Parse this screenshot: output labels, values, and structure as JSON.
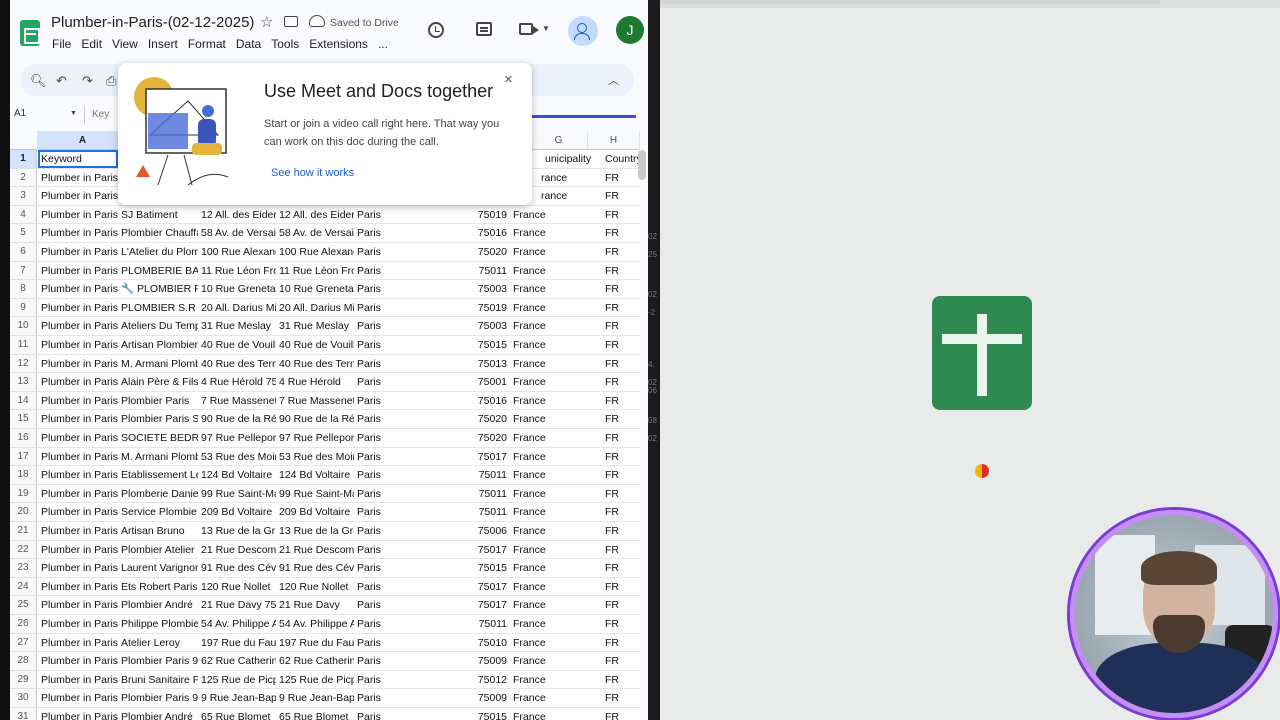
{
  "doc": {
    "title": "Plumber-in-Paris-(02-12-2025)",
    "saved_status": "Saved to Drive",
    "avatar_letter": "J",
    "menu": [
      "File",
      "Edit",
      "View",
      "Insert",
      "Format",
      "Data",
      "Tools",
      "Extensions",
      "..."
    ],
    "name_box": "A1",
    "formula_preview": "Key"
  },
  "popup": {
    "title": "Use Meet and Docs together",
    "body": "Start or join a video call right here. That way you can work on this doc during the call.",
    "link": "See how it works",
    "close": "×"
  },
  "grid": {
    "columns": [
      "A",
      "G",
      "H"
    ],
    "header_row": {
      "row_number": "1",
      "keyword": "Keyword",
      "municipality": "unicipality",
      "country": "Country"
    },
    "rows": [
      {
        "n": "2",
        "a": "Plumber in Paris",
        "b": "",
        "c": "",
        "d": "",
        "e": "",
        "f": "rance",
        "g": "FR"
      },
      {
        "n": "3",
        "a": "Plumber in Paris",
        "b": "",
        "c": "",
        "d": "",
        "e": "",
        "f": "rance",
        "g": "FR"
      },
      {
        "n": "4",
        "a": "Plumber in Paris",
        "b": "SJ Batiment",
        "c": "12 All. des Eider",
        "d": "12 All. des Eider",
        "e": "Paris",
        "z": "75019",
        "f": "France",
        "g": "FR"
      },
      {
        "n": "5",
        "a": "Plumber in Paris",
        "b": "Plombier Chauffa",
        "c": "58 Av. de Versail",
        "d": "58 Av. de Versail",
        "e": "Paris",
        "z": "75016",
        "f": "France",
        "g": "FR"
      },
      {
        "n": "6",
        "a": "Plumber in Paris",
        "b": "L'Atelier du Plom",
        "c": "100 Rue Alexand",
        "d": "100 Rue Alexand",
        "e": "Paris",
        "z": "75020",
        "f": "France",
        "g": "FR"
      },
      {
        "n": "7",
        "a": "Plumber in Paris",
        "b": "PLOMBERIE BA",
        "c": "11 Rue Léon Fro",
        "d": "11 Rue Léon Fro",
        "e": "Paris",
        "z": "75011",
        "f": "France",
        "g": "FR"
      },
      {
        "n": "8",
        "a": "Plumber in Paris",
        "b": "🔧 PLOMBIER P",
        "c": "10 Rue Greneta",
        "d": "10 Rue Greneta",
        "e": "Paris",
        "z": "75003",
        "f": "France",
        "g": "FR"
      },
      {
        "n": "9",
        "a": "Plumber in Paris",
        "b": "PLOMBIER S.R",
        "c": "20 All. Darius Mi",
        "d": "20 All. Darius Mi",
        "e": "Paris",
        "z": "75019",
        "f": "France",
        "g": "FR"
      },
      {
        "n": "10",
        "a": "Plumber in Paris",
        "b": "Ateliers Du Temp",
        "c": "31 Rue Meslay",
        "d": "31 Rue Meslay",
        "e": "Paris",
        "z": "75003",
        "f": "France",
        "g": "FR"
      },
      {
        "n": "11",
        "a": "Plumber in Paris",
        "b": "Artisan Plombier",
        "c": "40 Rue de Vouill",
        "d": "40 Rue de Vouill",
        "e": "Paris",
        "z": "75015",
        "f": "France",
        "g": "FR"
      },
      {
        "n": "12",
        "a": "Plumber in Paris",
        "b": "M. Armani Plomb",
        "c": "40 Rue des Tern",
        "d": "40 Rue des Tern",
        "e": "Paris",
        "z": "75013",
        "f": "France",
        "g": "FR"
      },
      {
        "n": "13",
        "a": "Plumber in Paris",
        "b": "Alain Père & Fils",
        "c": "4 Rue Hérold 75",
        "d": "4 Rue Hérold",
        "e": "Paris",
        "z": "75001",
        "f": "France",
        "g": "FR"
      },
      {
        "n": "14",
        "a": "Plumber in Paris",
        "b": "Plombier Paris",
        "c": "7 Rue Massenet",
        "d": "7 Rue Massenet",
        "e": "Paris",
        "z": "75016",
        "f": "France",
        "g": "FR"
      },
      {
        "n": "15",
        "a": "Plumber in Paris",
        "b": "Plombier Paris S",
        "c": "90 Rue de la Ré",
        "d": "90 Rue de la Ré",
        "e": "Paris",
        "z": "75020",
        "f": "France",
        "g": "FR"
      },
      {
        "n": "16",
        "a": "Plumber in Paris",
        "b": "SOCIETE BEDR",
        "c": "97 Rue Pellepor",
        "d": "97 Rue Pellepor",
        "e": "Paris",
        "z": "75020",
        "f": "France",
        "g": "FR"
      },
      {
        "n": "17",
        "a": "Plumber in Paris",
        "b": "M. Armani Plomb",
        "c": "53 Rue des Moir",
        "d": "53 Rue des Moir",
        "e": "Paris",
        "z": "75017",
        "f": "France",
        "g": "FR"
      },
      {
        "n": "18",
        "a": "Plumber in Paris",
        "b": "Etablissement Le",
        "c": "124 Bd Voltaire",
        "d": "124 Bd Voltaire",
        "e": "Paris",
        "z": "75011",
        "f": "France",
        "g": "FR"
      },
      {
        "n": "19",
        "a": "Plumber in Paris",
        "b": "Plomberie Danie",
        "c": "99 Rue Saint-Ma",
        "d": "99 Rue Saint-Ma",
        "e": "Paris",
        "z": "75011",
        "f": "France",
        "g": "FR"
      },
      {
        "n": "20",
        "a": "Plumber in Paris",
        "b": "Service Plombie",
        "c": "209 Bd Voltaire",
        "d": "209 Bd Voltaire",
        "e": "Paris",
        "z": "75011",
        "f": "France",
        "g": "FR"
      },
      {
        "n": "21",
        "a": "Plumber in Paris",
        "b": "Artisan Bruno",
        "c": "13 Rue de la Gr",
        "d": "13 Rue de la Gra",
        "e": "Paris",
        "z": "75006",
        "f": "France",
        "g": "FR"
      },
      {
        "n": "22",
        "a": "Plumber in Paris",
        "b": "Plombier Atelier",
        "c": "21 Rue Descom",
        "d": "21 Rue Descomb",
        "e": "Paris",
        "z": "75017",
        "f": "France",
        "g": "FR"
      },
      {
        "n": "23",
        "a": "Plumber in Paris",
        "b": "Laurent Varignor",
        "c": "91 Rue des Cév",
        "d": "91 Rue des Cév",
        "e": "Paris",
        "z": "75015",
        "f": "France",
        "g": "FR"
      },
      {
        "n": "24",
        "a": "Plumber in Paris",
        "b": "Ets Robert Paris",
        "c": "120 Rue Nollet",
        "d": "120 Rue Nollet",
        "e": "Paris",
        "z": "75017",
        "f": "France",
        "g": "FR"
      },
      {
        "n": "25",
        "a": "Plumber in Paris",
        "b": "Plombier André",
        "c": "21 Rue Davy 75",
        "d": "21 Rue Davy",
        "e": "Paris",
        "z": "75017",
        "f": "France",
        "g": "FR"
      },
      {
        "n": "26",
        "a": "Plumber in Paris",
        "b": "Philippe Plombie",
        "c": "54 Av. Philippe A",
        "d": "54 Av. Philippe A",
        "e": "Paris",
        "z": "75011",
        "f": "France",
        "g": "FR"
      },
      {
        "n": "27",
        "a": "Plumber in Paris",
        "b": "Atelier Leroy",
        "c": "197 Rue du Faul",
        "d": "197 Rue du Faul",
        "e": "Paris",
        "z": "75010",
        "f": "France",
        "g": "FR"
      },
      {
        "n": "28",
        "a": "Plumber in Paris",
        "b": "Plombier Paris 9",
        "c": "62 Rue Catherin",
        "d": "62 Rue Catherin",
        "e": "Paris",
        "z": "75009",
        "f": "France",
        "g": "FR"
      },
      {
        "n": "29",
        "a": "Plumber in Paris",
        "b": "Bruni Sanitaire F",
        "c": "125 Rue de Picp",
        "d": "125 Rue de Picp",
        "e": "Paris",
        "z": "75012",
        "f": "France",
        "g": "FR"
      },
      {
        "n": "30",
        "a": "Plumber in Paris",
        "b": "Plombier Paris 9",
        "c": "9 Rue Jean-Bap",
        "d": "9 Rue Jean-Bap",
        "e": "Paris",
        "z": "75009",
        "f": "France",
        "g": "FR"
      },
      {
        "n": "31",
        "a": "Plumber in Paris",
        "b": "Plombier André",
        "c": "65 Rue Blomet",
        "d": "65 Rue Blomet",
        "e": "Paris",
        "z": "75015",
        "f": "France",
        "g": "FR"
      }
    ]
  },
  "divider_snippets": [
    "02",
    "25",
    "02",
    "-2",
    "4.",
    "02",
    "06",
    "08",
    "02"
  ],
  "colors": {
    "sheets_green": "#2e8a4f",
    "selection_blue": "#1a73e8",
    "link_blue": "#1a5dc9",
    "cam_ring": "#c48ef4"
  }
}
